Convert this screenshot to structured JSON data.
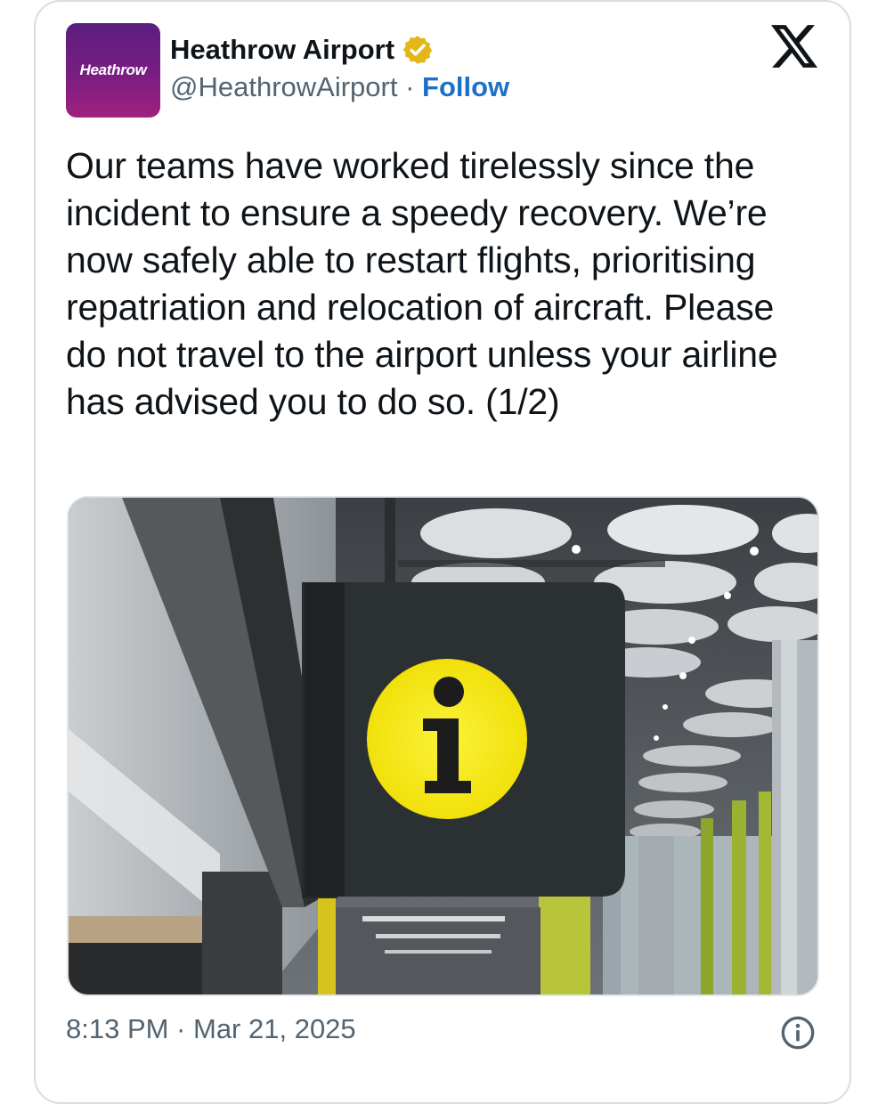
{
  "author": {
    "avatar_text": "Heathrow",
    "display_name": "Heathrow Airport",
    "handle": "@HeathrowAirport",
    "separator": " · ",
    "follow_label": "Follow",
    "verified_icon": "gold-verified-badge-icon"
  },
  "platform": {
    "logo_icon": "x-logo-icon"
  },
  "tweet": {
    "text": "Our teams have worked tirelessly since the incident to ensure a speedy recovery. We’re now safely able to restart flights, prioritising repatriation and relocation of aircraft. Please do not travel to the airport unless your airline has advised you to do so. (1/2)",
    "image_subject": "information-sign-icon"
  },
  "footer": {
    "timestamp": "8:13 PM · Mar 21, 2025",
    "info_icon": "info-circle-icon"
  },
  "colors": {
    "link": "#1d70c8",
    "text": "#0f1419",
    "secondary": "#536471",
    "avatar_gradient_start": "#5a1e7f",
    "avatar_gradient_end": "#a0217c",
    "badge_gold": "#e2b719",
    "sign_yellow": "#f5e90e"
  }
}
